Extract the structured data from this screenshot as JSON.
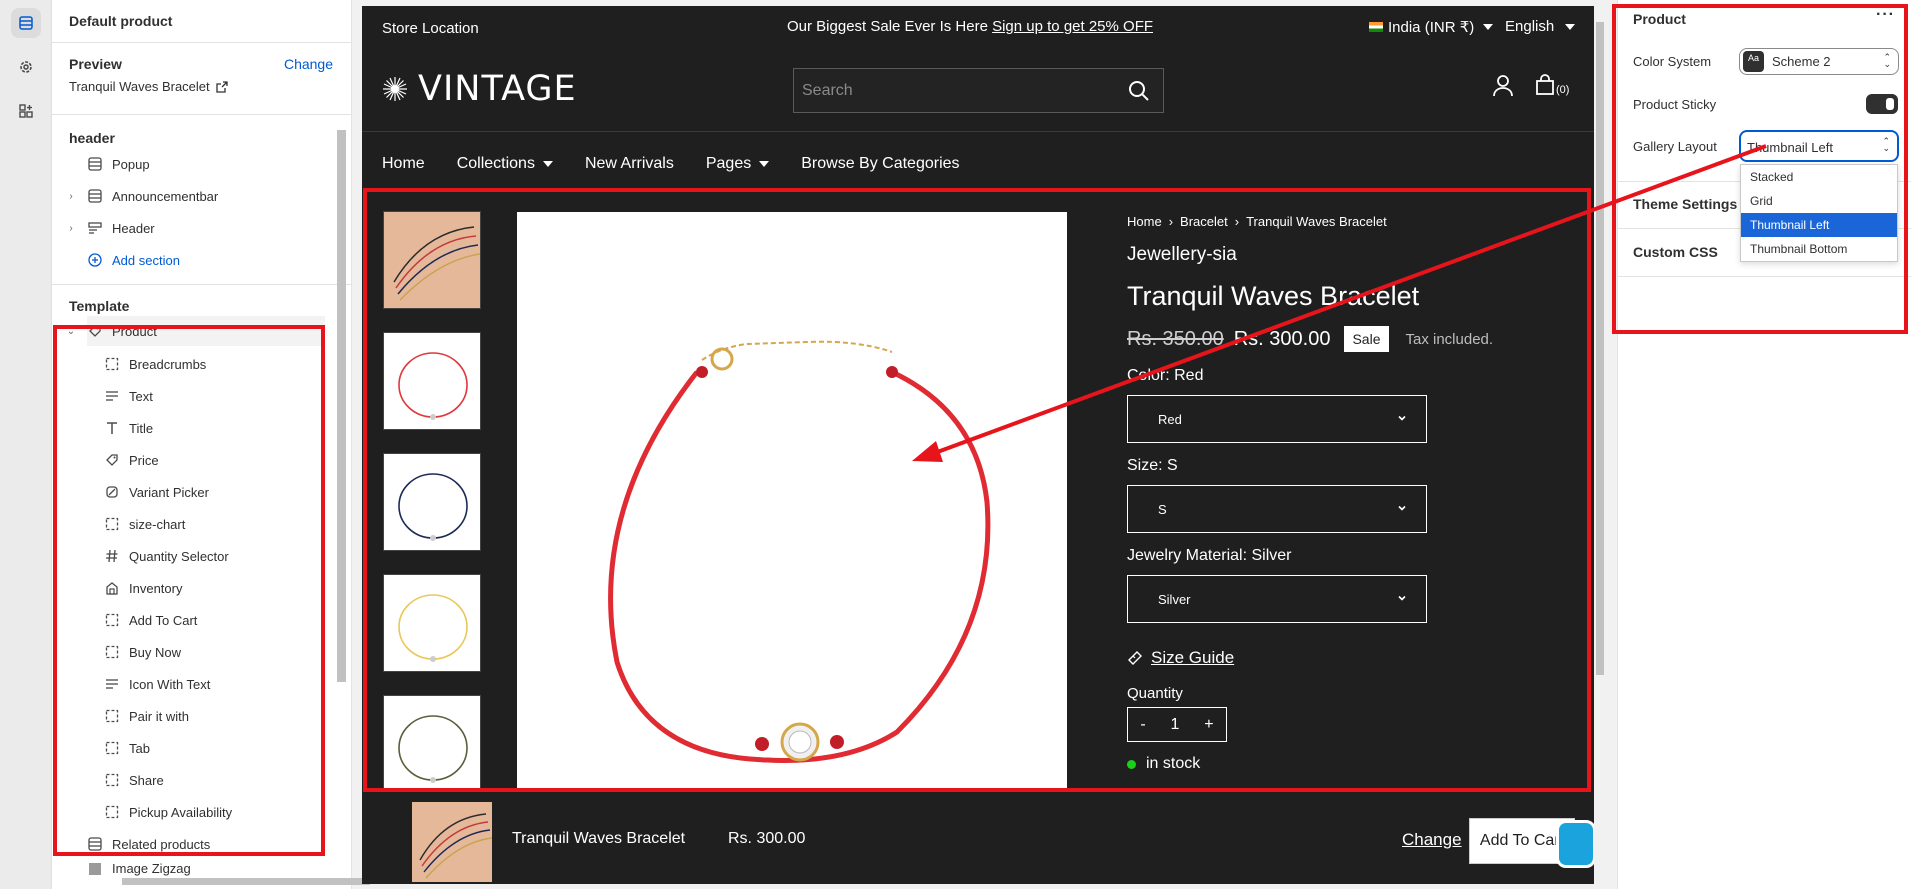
{
  "left_panel": {
    "title": "Default product",
    "preview_label": "Preview",
    "change_label": "Change",
    "preview_value": "Tranquil Waves Bracelet",
    "header_section": "header",
    "header_items": [
      "Popup",
      "Announcementbar",
      "Header"
    ],
    "add_section": "Add section",
    "template_section": "Template",
    "product_label": "Product",
    "product_blocks": [
      "Breadcrumbs",
      "Text",
      "Title",
      "Price",
      "Variant Picker",
      "size-chart",
      "Quantity Selector",
      "Inventory",
      "Add To Cart",
      "Buy Now",
      "Icon With Text",
      "Pair it with",
      "Tab",
      "Share",
      "Pickup Availability"
    ],
    "related_products": "Related products",
    "image_zigzag": "Image Zigzag"
  },
  "store": {
    "store_location": "Store Location",
    "promo_text": "Our Biggest Sale Ever Is Here ",
    "promo_link": "Sign up to get 25% OFF",
    "currency": "India (INR ₹)",
    "language": "English",
    "logo_text": "VINTAGE",
    "search_placeholder": "Search",
    "cart_count": "(0)",
    "nav": [
      "Home",
      "Collections",
      "New Arrivals",
      "Pages",
      "Browse By Categories"
    ],
    "breadcrumb": [
      "Home",
      "Bracelet",
      "Tranquil Waves Bracelet"
    ],
    "breadcrumb_sep": "›",
    "brand": "Jewellery-sia",
    "product_title": "Tranquil Waves Bracelet",
    "old_price": "Rs. 350.00",
    "price": "Rs. 300.00",
    "sale_badge": "Sale",
    "tax_note": "Tax included.",
    "color_label": "Color: Red",
    "color_value": "Red",
    "size_label": "Size: S",
    "size_value": "S",
    "material_label": "Jewelry Material: Silver",
    "material_value": "Silver",
    "size_guide": "Size Guide",
    "quantity_label": "Quantity",
    "qty_minus": "-",
    "qty_value": "1",
    "qty_plus": "+",
    "stock_text": "in stock",
    "sticky_name": "Tranquil Waves Bracelet",
    "sticky_price": "Rs. 300.00",
    "sticky_change": "Change",
    "sticky_add": "Add To Cart",
    "thumbnail_colors": [
      "multi",
      "#e0373b",
      "#1d2a55",
      "#e9c75a",
      "#5b5f3a"
    ]
  },
  "right_panel": {
    "title": "Product",
    "more": "···",
    "color_system_label": "Color System",
    "scheme_icon_text": "Aa",
    "scheme_value": "Scheme 2",
    "product_sticky_label": "Product Sticky",
    "product_sticky_on": true,
    "gallery_layout_label": "Gallery Layout",
    "gallery_layout_value": "Thumbnail Left",
    "gallery_options": [
      "Stacked",
      "Grid",
      "Thumbnail Left",
      "Thumbnail Bottom"
    ],
    "theme_settings": "Theme Settings",
    "custom_css": "Custom CSS"
  },
  "colors": {
    "accent": "#005bd3",
    "highlight": "#e8141c",
    "store_bg": "#1f1f1f"
  }
}
